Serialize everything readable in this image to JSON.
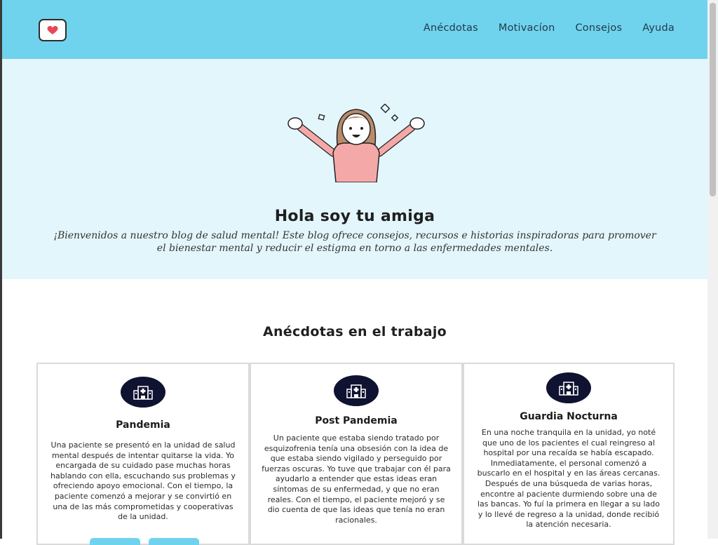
{
  "header": {
    "logo_icon": "heart-icon",
    "nav": [
      {
        "label": "Anécdotas"
      },
      {
        "label": "Motivacíon"
      },
      {
        "label": "Consejos"
      },
      {
        "label": "Ayuda"
      }
    ]
  },
  "hero": {
    "illustration": "cheering-girl-illustration",
    "title": "Hola soy tu amiga",
    "description": "¡Bienvenidos a nuestro blog de salud mental! Este blog ofrece consejos, recursos e historias inspiradoras para promover el bienestar mental y reducir el estigma en torno a las enfermedades mentales."
  },
  "section": {
    "title": "Anécdotas en el trabajo"
  },
  "cards": [
    {
      "icon": "hospital-icon",
      "title": "Pandemia",
      "text": "Una paciente se presentó en la unidad de salud mental después de intentar quitarse la vida. Yo encargada de su cuidado pase muchas horas hablando con ella, escuchando sus problemas y ofreciendo apoyo emocional. Con el tiempo, la paciente comenzó a mejorar y se convirtió en una de las más comprometidas y cooperativas de la unidad."
    },
    {
      "icon": "hospital-icon",
      "title": "Post Pandemia",
      "text": "Un paciente que estaba siendo tratado por esquizofrenia tenía una obsesión con la idea de que estaba siendo vigilado y perseguido por fuerzas oscuras. Yo tuve que trabajar con él para ayudarlo a entender que estas ideas eran síntomas de su enfermedad, y que no eran reales. Con el tiempo, el paciente mejoró y se dio cuenta de que las ideas que tenía no eran racionales."
    },
    {
      "icon": "hospital-icon",
      "title": "Guardia Nocturna",
      "text": "En una noche tranquila en la unidad, yo noté que uno de los pacientes el cual reingreso al hospital por una recaída se había escapado. Inmediatamente, el personal comenzó a buscarlo en el hospital y en las áreas cercanas. Después de una búsqueda de varias horas, encontre al paciente durmiendo sobre una de las bancas. Yo fuí la primera en llegar a su lado y lo llevé de regreso a la unidad, donde recibió la atención necesaria."
    }
  ],
  "colors": {
    "header_bg": "#6fd3ee",
    "hero_bg": "#e3f6fc",
    "icon_circle": "#0f1230",
    "heart": "#e8475a"
  }
}
